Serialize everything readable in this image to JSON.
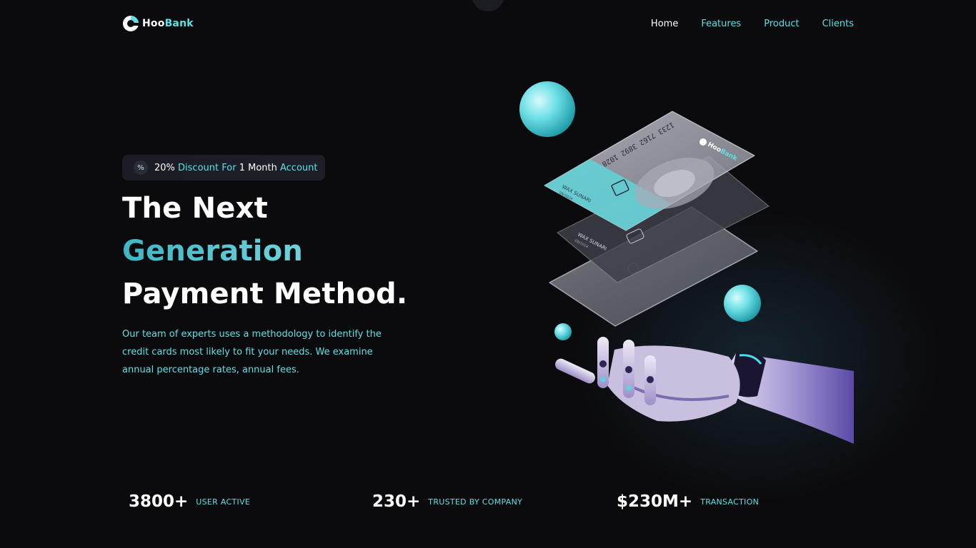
{
  "brand": {
    "name_part1": "Hoo",
    "name_part2": "Bank"
  },
  "nav": {
    "items": [
      {
        "label": "Home",
        "active": true
      },
      {
        "label": "Features",
        "active": false
      },
      {
        "label": "Product",
        "active": false
      },
      {
        "label": "Clients",
        "active": false
      }
    ]
  },
  "promo": {
    "icon": "discount-icon",
    "parts": [
      "20%",
      " Discount For ",
      "1",
      " Month ",
      "Account"
    ]
  },
  "hero": {
    "title_line1": "The Next",
    "title_line2": "Generation",
    "title_line3": "Payment Method.",
    "description": "Our team of experts uses a methodology to identify the credit cards most likely to fit your needs. We examine annual percentage rates, annual fees."
  },
  "card": {
    "number": "1233 7162 3892 1028",
    "holder": "WAX SUNARI",
    "expiry": "09/2024",
    "brand_part1": "Hoo",
    "brand_part2": "Bank"
  },
  "stats": [
    {
      "value": "3800+",
      "label": "USER ACTIVE"
    },
    {
      "value": "230+",
      "label": "TRUSTED BY COMPANY"
    },
    {
      "value": "$230M+",
      "label": "TRANSACTION"
    }
  ],
  "colors": {
    "accent": "#5ce1e6",
    "background": "#0b0b0d",
    "promo_bg": "#1c1c26"
  }
}
